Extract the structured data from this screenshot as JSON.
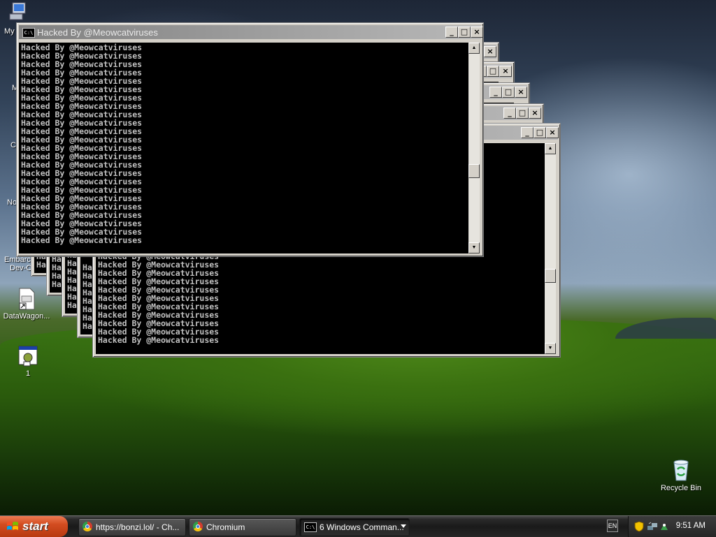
{
  "desktop": {
    "icons": [
      {
        "label": "My",
        "name": "my-computer"
      },
      {
        "label": "Embarc",
        "label2": "Dev-C",
        "name": "embarcadero-devcpp"
      },
      {
        "label": "DataWagon...",
        "name": "datawagon"
      },
      {
        "label": "1",
        "name": "program-1"
      },
      {
        "label": "Recycle Bin",
        "name": "recycle-bin"
      }
    ],
    "partial_letters": [
      "M",
      "C",
      "No"
    ]
  },
  "console": {
    "title": "Hacked By @Meowcatviruses",
    "line": "Hacked By @Meowcatviruses",
    "partial": "Ha",
    "icon_text": "C:\\",
    "buttons": {
      "minimize": "_",
      "maximize": "□",
      "close": "×"
    },
    "scroll": {
      "up": "▲",
      "down": "▼"
    }
  },
  "taskbar": {
    "start_label": "start",
    "tasks": [
      {
        "label": "https://bonzi.lol/ - Ch..."
      },
      {
        "label": "Chromium"
      },
      {
        "label": "6 Windows Comman..."
      }
    ],
    "lang": "EN",
    "clock": "9:51 AM"
  },
  "colors": {
    "console_bg": "#000000",
    "console_text": "#c0c0c0",
    "titlebar_inactive": "#808080",
    "start_button": "#d24c20"
  }
}
